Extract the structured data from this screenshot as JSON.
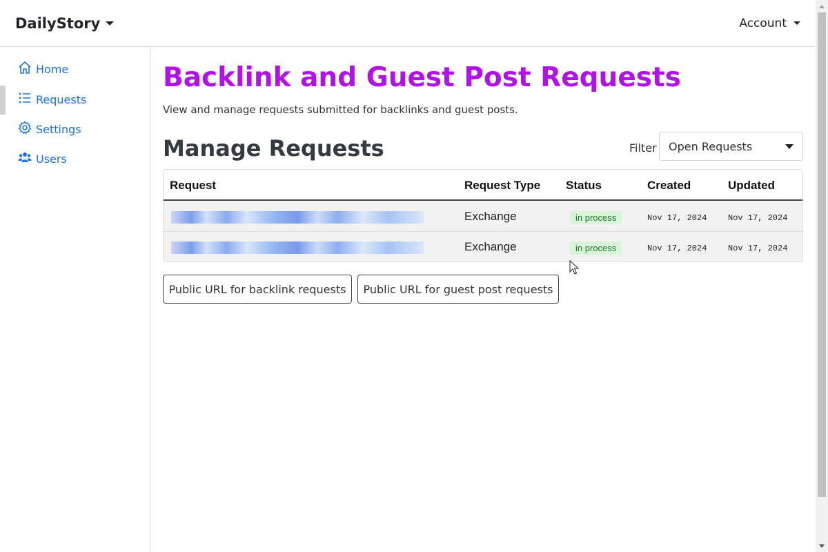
{
  "navbar": {
    "brand": "DailyStory",
    "account": "Account"
  },
  "sidebar": {
    "items": [
      {
        "label": "Home",
        "icon": "home-icon",
        "active": false
      },
      {
        "label": "Requests",
        "icon": "list-icon",
        "active": true
      },
      {
        "label": "Settings",
        "icon": "gear-icon",
        "active": false
      },
      {
        "label": "Users",
        "icon": "users-icon",
        "active": false
      }
    ]
  },
  "main": {
    "title": "Backlink and Guest Post Requests",
    "subtitle": "View and manage requests submitted for backlinks and guest posts.",
    "section_title": "Manage Requests",
    "filter": {
      "label": "Filter",
      "selected": "Open Requests"
    },
    "table": {
      "headers": [
        "Request",
        "Request Type",
        "Status",
        "Created",
        "Updated"
      ],
      "rows": [
        {
          "request": "",
          "type": "Exchange",
          "status": "in process",
          "created": "Nov 17, 2024",
          "updated": "Nov 17, 2024"
        },
        {
          "request": "",
          "type": "Exchange",
          "status": "in process",
          "created": "Nov 17, 2024",
          "updated": "Nov 17, 2024"
        }
      ]
    },
    "buttons": {
      "backlink": "Public URL for backlink requests",
      "guest": "Public URL for guest post requests"
    }
  },
  "colors": {
    "title": "#b012e8",
    "link": "#1a73e8",
    "badge_bg": "#d9f5d9",
    "badge_text": "#1e7b2e"
  }
}
